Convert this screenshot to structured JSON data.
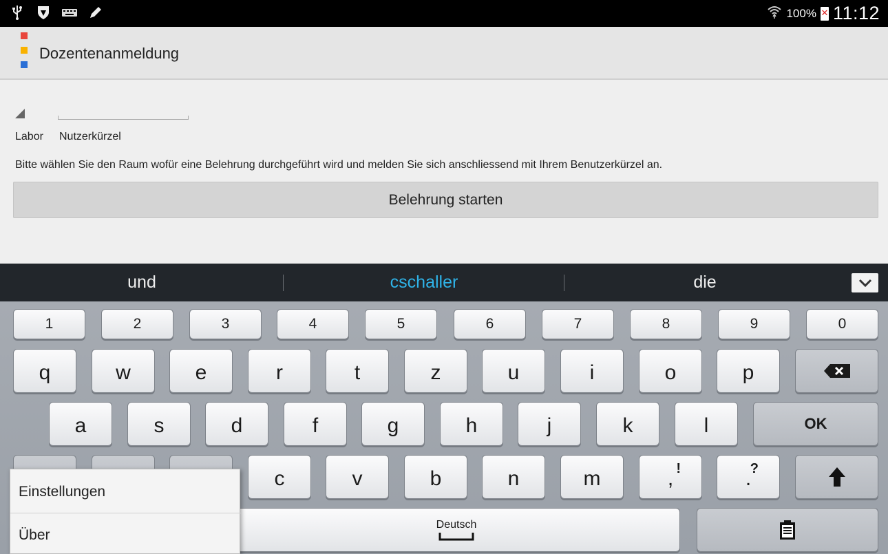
{
  "status_bar": {
    "icons": [
      "usb-icon",
      "shield-icon",
      "keyboard-icon",
      "pencil-icon"
    ],
    "battery_percent": "100%",
    "time": "11:12"
  },
  "action_bar": {
    "title": "Dozentenanmeldung",
    "logo_colors": [
      "#e8453c",
      "#f9b200",
      "#2a6fd6"
    ]
  },
  "form": {
    "room_label": "Labor",
    "user_label": "Nutzerkürzel",
    "user_value": "",
    "instruction": "Bitte wählen Sie den Raum wofür eine Belehrung durchgeführt wird und melden Sie sich anschliessend mit Ihrem Benutzerkürzel an.",
    "start_button": "Belehrung starten"
  },
  "suggestions": {
    "items": [
      "und",
      "cschaller",
      "die"
    ],
    "highlight_color": "#2fb3e8"
  },
  "keyboard": {
    "numbers": [
      "1",
      "2",
      "3",
      "4",
      "5",
      "6",
      "7",
      "8",
      "9",
      "0"
    ],
    "row1": [
      "q",
      "w",
      "e",
      "r",
      "t",
      "z",
      "u",
      "i",
      "o",
      "p"
    ],
    "row2": [
      "a",
      "s",
      "d",
      "f",
      "g",
      "h",
      "j",
      "k",
      "l"
    ],
    "ok_label": "OK",
    "row3": [
      "c",
      "v",
      "b",
      "n",
      "m"
    ],
    "comma": ",",
    "comma_alt": "!",
    "period": ".",
    "period_alt": "?",
    "space_language": "Deutsch"
  },
  "popup_menu": {
    "items": [
      "Einstellungen",
      "Über"
    ]
  }
}
